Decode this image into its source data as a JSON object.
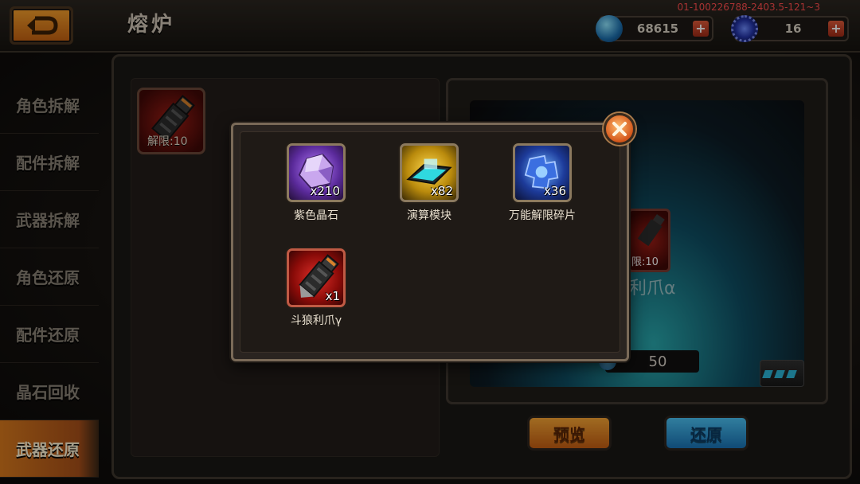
{
  "header": {
    "title": "熔炉",
    "debug_id": "01-100226788-2403.5-121~3",
    "crystal_amount": "68615",
    "gear_amount": "16",
    "plus_label": "+"
  },
  "sidebar": {
    "items": [
      {
        "label": "角色拆解"
      },
      {
        "label": "配件拆解"
      },
      {
        "label": "武器拆解"
      },
      {
        "label": "角色还原"
      },
      {
        "label": "配件还原"
      },
      {
        "label": "晶石回收"
      },
      {
        "label": "武器还原"
      }
    ],
    "active_index": 6
  },
  "main": {
    "slot_limit": "解限:10",
    "preview_limit": "限:10",
    "preview_name": "利爪α",
    "cost": "50",
    "preview_button": "预览",
    "restore_button": "还原"
  },
  "popup": {
    "rewards": [
      {
        "name": "紫色晶石",
        "count": "x210",
        "icon": "purple-crystal-icon"
      },
      {
        "name": "演算模块",
        "count": "x82",
        "icon": "calc-module-icon"
      },
      {
        "name": "万能解限碎片",
        "count": "x36",
        "icon": "limit-shard-icon"
      },
      {
        "name": "斗狼利爪γ",
        "count": "x1",
        "icon": "wolf-claw-icon"
      }
    ]
  },
  "colors": {
    "accent_orange": "#d8791c",
    "accent_blue": "#1a73b5",
    "debug_red": "#ff4e4e"
  }
}
